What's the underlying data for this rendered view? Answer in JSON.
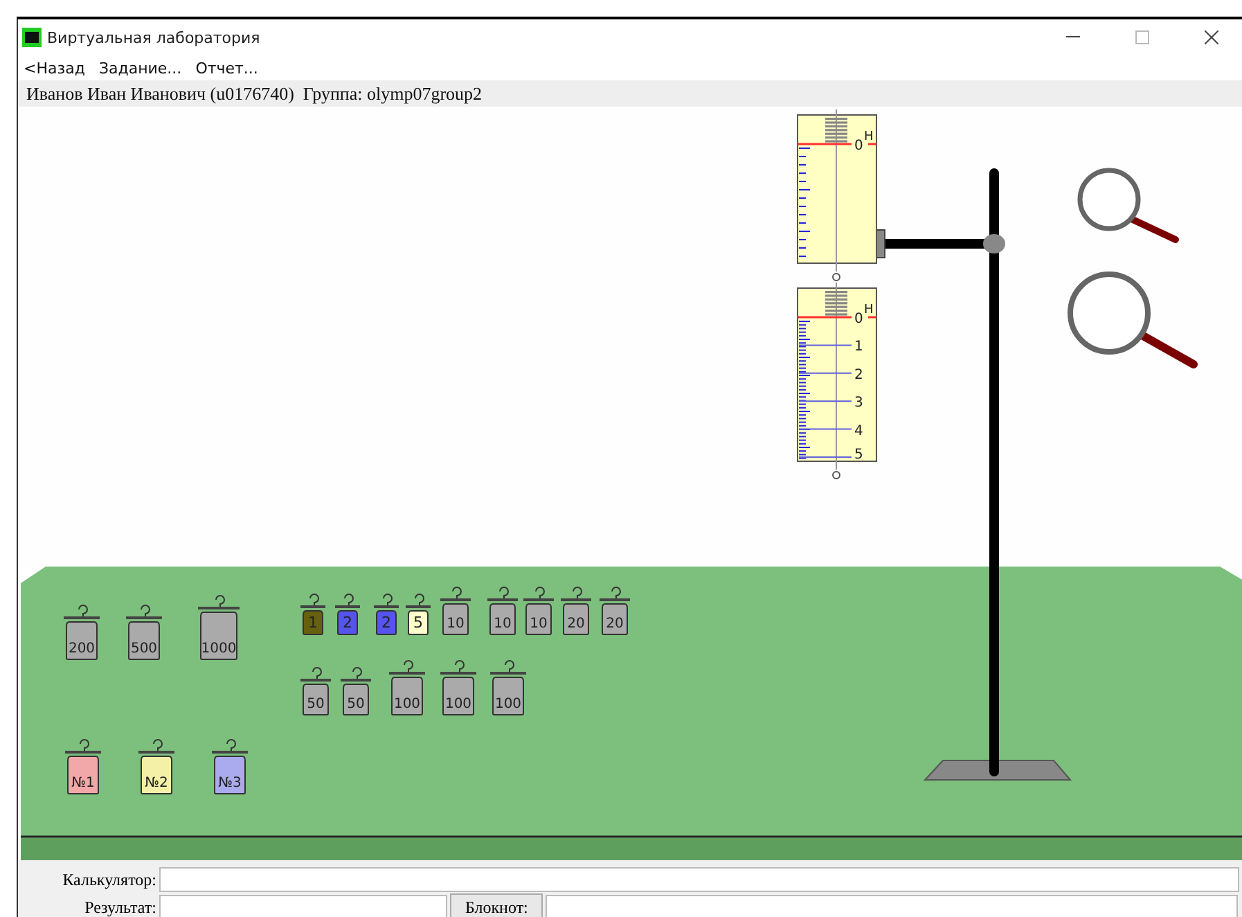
{
  "window": {
    "title": "Виртуальная лаборатория"
  },
  "menu": [
    {
      "label": "<Назад"
    },
    {
      "label": "Задание..."
    },
    {
      "label": "Отчет..."
    }
  ],
  "user_bar": {
    "text": "Иванов Иван Иванович (u0176740)  Группа: olymp07group2"
  },
  "dynamometers": [
    {
      "unit": "H",
      "scale_labels": [
        "0"
      ]
    },
    {
      "unit": "H",
      "scale_labels": [
        "0",
        "1",
        "2",
        "3",
        "4",
        "5"
      ]
    }
  ],
  "weight_rows": [
    [
      {
        "label": "200",
        "kind": "large",
        "color": "#aaaaaa"
      },
      {
        "label": "500",
        "kind": "large",
        "color": "#aaaaaa"
      },
      {
        "label": "1000",
        "kind": "xlarge",
        "color": "#aaaaaa"
      }
    ],
    [
      {
        "label": "1",
        "kind": "small",
        "color": "#66600f"
      },
      {
        "label": "2",
        "kind": "small",
        "color": "#5555ee"
      },
      {
        "label": "2",
        "kind": "small",
        "color": "#5555ee"
      },
      {
        "label": "5",
        "kind": "small",
        "color": "#ffffcc"
      },
      {
        "label": "10",
        "kind": "medium",
        "color": "#aaaaaa"
      },
      {
        "label": "10",
        "kind": "medium",
        "color": "#aaaaaa"
      },
      {
        "label": "10",
        "kind": "medium",
        "color": "#aaaaaa"
      },
      {
        "label": "20",
        "kind": "medium",
        "color": "#aaaaaa"
      },
      {
        "label": "20",
        "kind": "medium",
        "color": "#aaaaaa"
      }
    ],
    [
      {
        "label": "50",
        "kind": "medium",
        "color": "#aaaaaa"
      },
      {
        "label": "50",
        "kind": "medium",
        "color": "#aaaaaa"
      },
      {
        "label": "100",
        "kind": "large",
        "color": "#aaaaaa"
      },
      {
        "label": "100",
        "kind": "large",
        "color": "#aaaaaa"
      },
      {
        "label": "100",
        "kind": "large",
        "color": "#aaaaaa"
      }
    ],
    [
      {
        "label": "№1",
        "kind": "large",
        "color": "#f2a8a8"
      },
      {
        "label": "№2",
        "kind": "large",
        "color": "#f5f0a8"
      },
      {
        "label": "№3",
        "kind": "large",
        "color": "#aaaaee"
      }
    ]
  ],
  "bottom": {
    "calculator_label": "Калькулятор:",
    "result_label": "Результат:",
    "notebook_button": "Блокнот:"
  }
}
